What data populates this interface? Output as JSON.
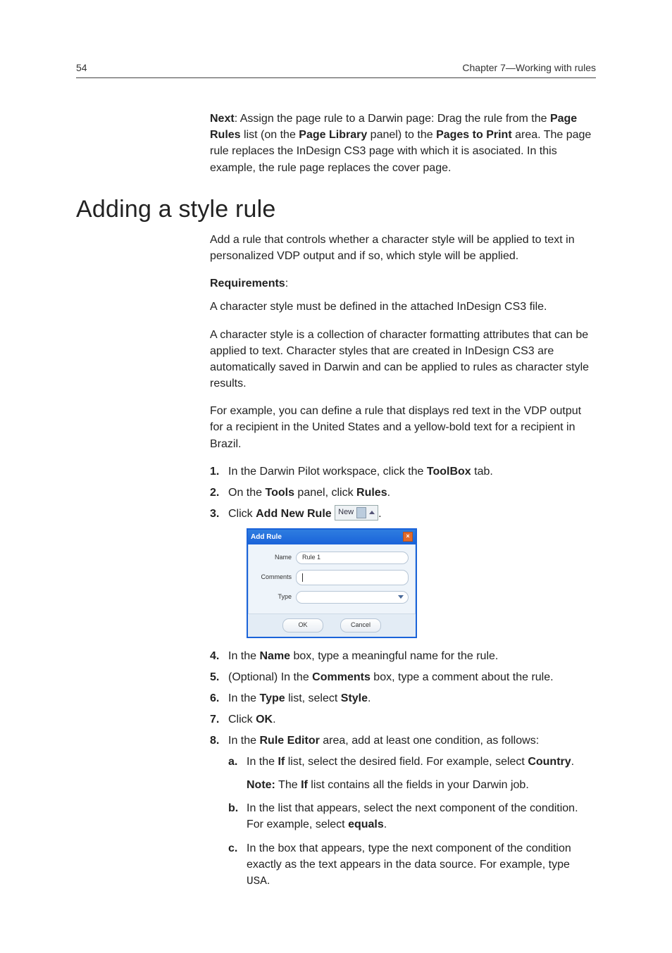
{
  "header": {
    "page_number": "54",
    "chapter": "Chapter 7—Working with rules"
  },
  "next_block": {
    "label": "Next",
    "sep": ": ",
    "t1": "Assign the page rule to a Darwin page: Drag the rule from the ",
    "b1": "Page Rules",
    "t2": " list (on the ",
    "b2": "Page Library",
    "t3": " panel) to the ",
    "b3": "Pages to Print",
    "t4": " area. The page rule replaces the InDesign CS3 page with which it is asociated. In this example, the rule page replaces the cover page."
  },
  "section_title": "Adding a style rule",
  "intro": "Add a rule that controls whether a character style will be applied to text in personalized VDP output and if so, which style will be applied.",
  "requirements_label": "Requirements",
  "requirements_sep": ":",
  "req_line": "A character style must be defined in the attached InDesign CS3 file.",
  "para2": "A character style is a collection of character formatting attributes that can be applied to text. Character styles that are created in InDesign CS3 are automatically saved in Darwin and can be applied to rules as character style results.",
  "para3": "For example, you can define a rule that displays red text in the VDP output for a recipient in the United States and a yellow-bold text for a recipient in Brazil.",
  "steps": {
    "s1": {
      "t1": "In the Darwin Pilot workspace, click the ",
      "b1": "ToolBox",
      "t2": " tab."
    },
    "s2": {
      "t1": "On the ",
      "b1": "Tools",
      "t2": " panel, click ",
      "b2": "Rules",
      "t3": "."
    },
    "s3": {
      "t1": "Click ",
      "b1": "Add New Rule",
      "t2": " ",
      "btn_label": "New",
      "t3": "."
    },
    "s4": {
      "t1": "In the ",
      "b1": "Name",
      "t2": " box, type a meaningful name for the rule."
    },
    "s5": {
      "t1": "(Optional) In the ",
      "b1": "Comments",
      "t2": " box, type a comment about the rule."
    },
    "s6": {
      "t1": "In the ",
      "b1": "Type",
      "t2": " list, select ",
      "b2": "Style",
      "t3": "."
    },
    "s7": {
      "t1": "Click ",
      "b1": "OK",
      "t2": "."
    },
    "s8": {
      "t1": "In the ",
      "b1": "Rule Editor",
      "t2": " area, add at least one condition, as follows:",
      "a": {
        "t1": "In the ",
        "b1": "If",
        "t2": " list, select the desired field. For example, select ",
        "b2": "Country",
        "t3": ".",
        "note_label": "Note:",
        "note_t1": " The ",
        "note_b1": "If",
        "note_t2": " list contains all the fields in your Darwin job."
      },
      "b": {
        "t1": "In the list that appears, select the next component of the condition. For example, select ",
        "b1": "equals",
        "t2": "."
      },
      "c": {
        "t1": "In the box that appears, type the next component of the condition exactly as the text appears in the data source. For example, type ",
        "code": "USA",
        "t2": "."
      }
    }
  },
  "dialog": {
    "title": "Add Rule",
    "name_label": "Name",
    "name_value": "Rule 1",
    "comments_label": "Comments",
    "comments_value": "",
    "type_label": "Type",
    "type_value": "",
    "ok": "OK",
    "cancel": "Cancel"
  }
}
